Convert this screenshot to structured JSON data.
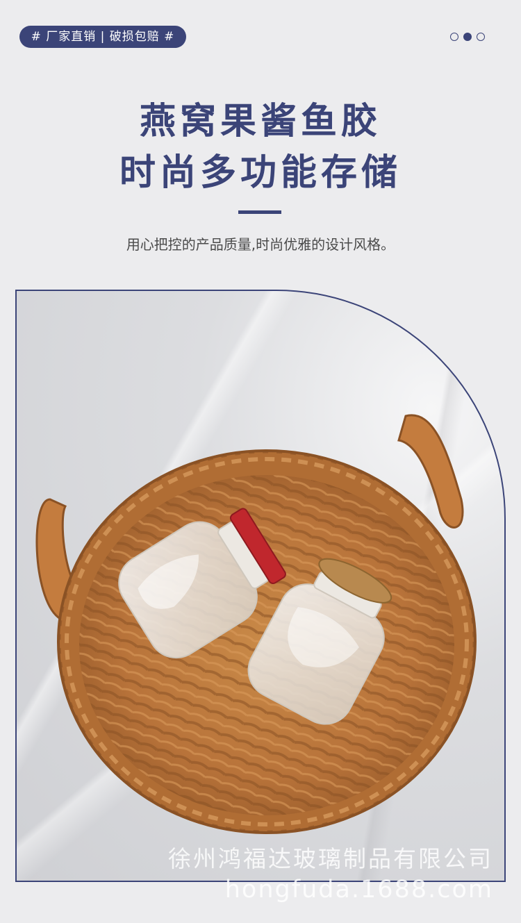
{
  "header": {
    "tag": "# 厂家直销 | 破损包赔 #",
    "carousel": {
      "total": 3,
      "active_index": 1
    }
  },
  "headline": {
    "line1": "燕窝果酱鱼胶",
    "line2": "时尚多功能存储"
  },
  "subtitle": "用心把控的产品质量,时尚优雅的设计风格。",
  "photo": {
    "description": "wicker-basket-with-glass-jars",
    "jar_lid_colors": [
      "#c0272d",
      "#b8894f"
    ]
  },
  "watermark": {
    "company": "徐州鸿福达玻璃制品有限公司",
    "site": "hongfuda.1688.com"
  },
  "colors": {
    "accent": "#3b4478",
    "background": "#ececee"
  }
}
